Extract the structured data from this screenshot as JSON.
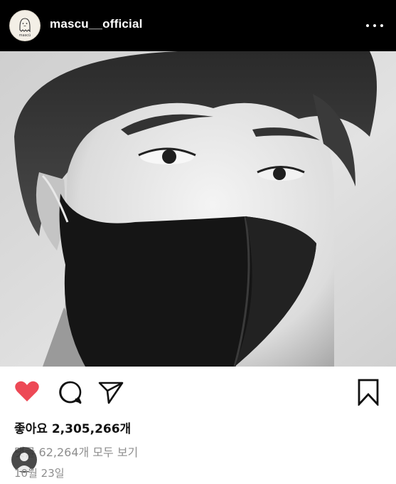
{
  "header": {
    "avatar_text": "mascü",
    "username": "mascu__official",
    "more_icon": "more-horizontal-icon"
  },
  "post": {
    "image_description_icon": "photo",
    "actions": {
      "like_icon": "heart-filled-icon",
      "comment_icon": "comment-icon",
      "share_icon": "paper-plane-icon",
      "save_icon": "bookmark-icon",
      "like_color": "#ed4956"
    },
    "likes_text": "좋아요 2,305,266개",
    "comments_text": "댓글 62,264개 모두 보기",
    "date_text": "10월 23일"
  }
}
